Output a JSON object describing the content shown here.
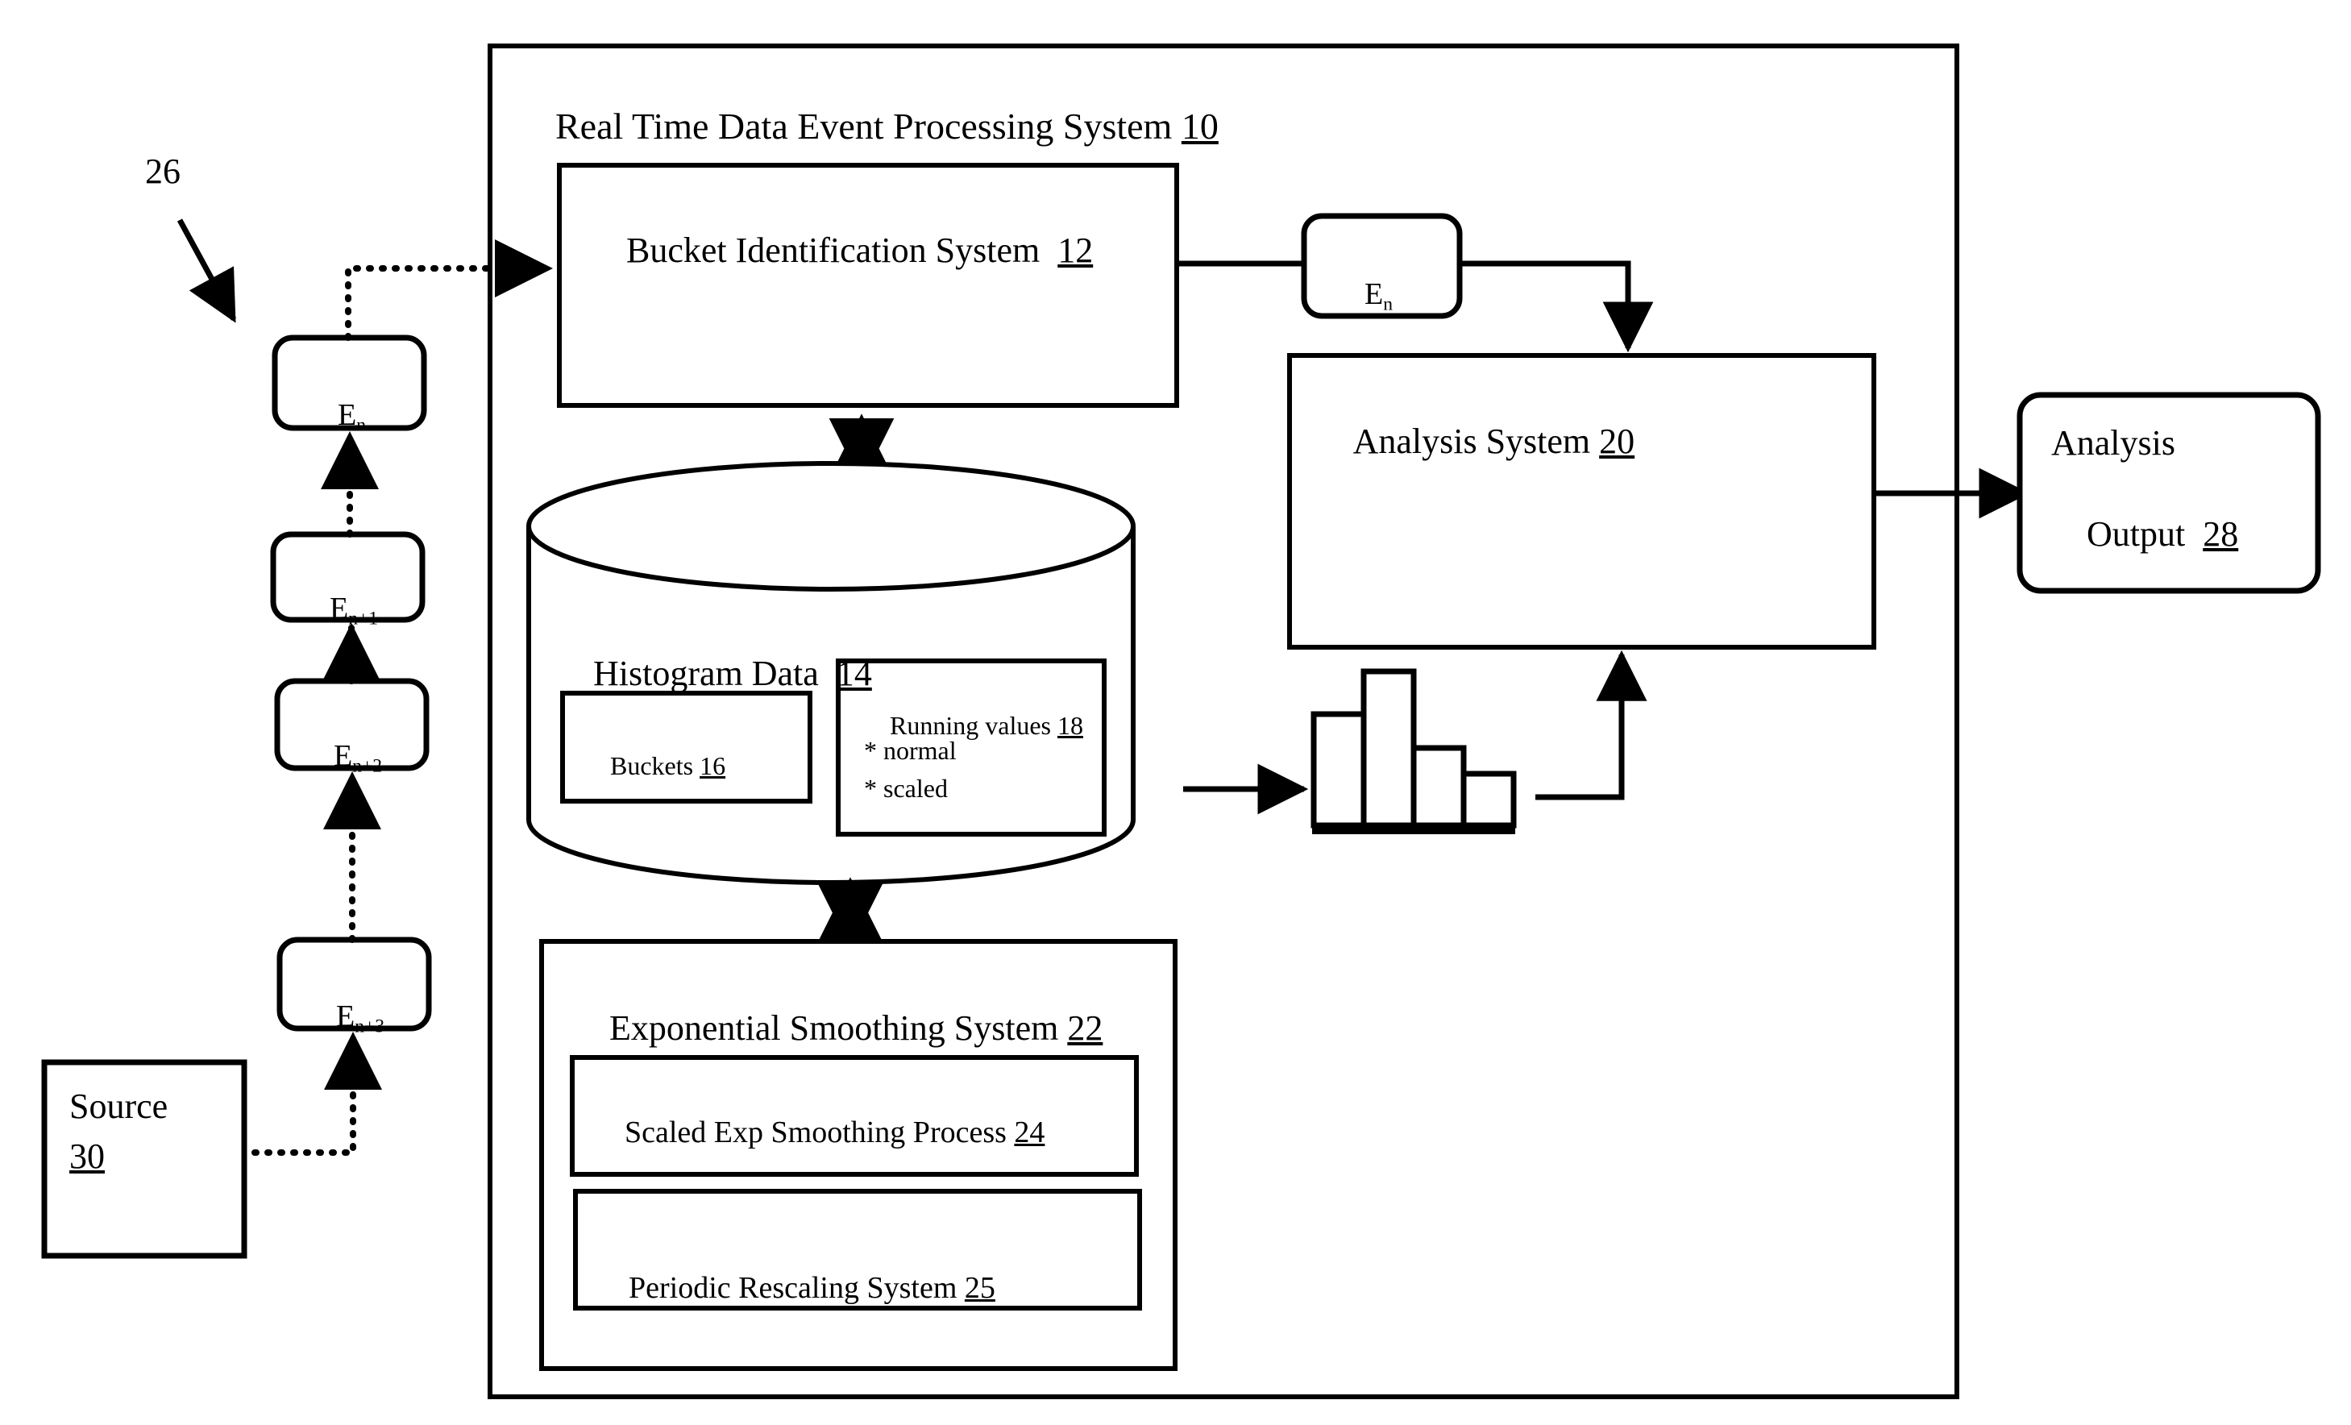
{
  "diagram": {
    "type": "patent-block-diagram",
    "system": {
      "title": "Real Time Data Event Processing System",
      "ref": "10"
    },
    "callout": {
      "label": "26",
      "target": "event-stream"
    },
    "event_stream": {
      "name": "event-stream",
      "events": [
        {
          "base": "E",
          "sub": "n",
          "label": "En"
        },
        {
          "base": "E",
          "sub": "n+1",
          "label": "En+1"
        },
        {
          "base": "E",
          "sub": "n+2",
          "label": "En+2"
        },
        {
          "base": "E",
          "sub": "n+3",
          "label": "En+3"
        }
      ]
    },
    "source": {
      "label": "Source",
      "ref": "30"
    },
    "bucket_identification": {
      "label": "Bucket Identification System",
      "ref": "12"
    },
    "event_out": {
      "base": "E",
      "sub": "n",
      "label": "En"
    },
    "analysis_system": {
      "label": "Analysis System",
      "ref": "20"
    },
    "analysis_output": {
      "line1": "Analysis",
      "line2": "Output",
      "ref": "28"
    },
    "histogram_store": {
      "label": "Histogram Data",
      "ref": "14",
      "buckets": {
        "label": "Buckets",
        "ref": "16"
      },
      "running_values": {
        "label": "Running values",
        "ref": "18",
        "items": [
          "* normal",
          "* scaled"
        ]
      }
    },
    "exponential_smoothing": {
      "label": "Exponential Smoothing System",
      "ref": "22",
      "children": [
        {
          "label": "Scaled Exp Smoothing Process",
          "ref": "24"
        },
        {
          "label": "Periodic Rescaling System",
          "ref": "25"
        }
      ]
    },
    "histogram_glyph": {
      "name": "histogram-bars-icon",
      "bars": [
        4,
        6,
        3,
        2
      ],
      "bar_count": 4
    },
    "colors": {
      "stroke": "#000000",
      "background": "#ffffff"
    }
  }
}
